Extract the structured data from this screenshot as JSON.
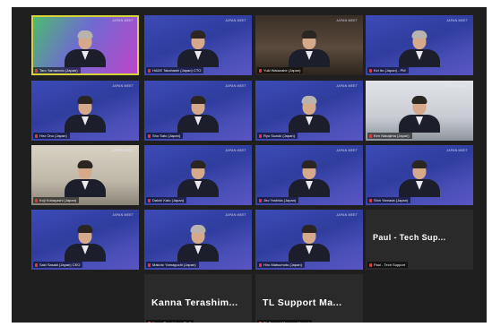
{
  "tiles": [
    {
      "name": "Taro Yamamoto (Japan)",
      "kind": "green",
      "active": true,
      "hair": "grey"
    },
    {
      "name": "HADE Takahashi (Japan) CTO",
      "kind": "video",
      "active": false,
      "hair": "dark"
    },
    {
      "name": "Yuki Watanabe (Japan)",
      "kind": "room3",
      "active": false,
      "hair": "dark"
    },
    {
      "name": "Kei Ito (Japan) - PM",
      "kind": "video",
      "active": false,
      "hair": "grey"
    },
    {
      "name": "Hiro Ono (Japan)",
      "kind": "video",
      "active": false,
      "hair": "dark"
    },
    {
      "name": "Sho Sato (Japan)",
      "kind": "video",
      "active": false,
      "hair": "dark"
    },
    {
      "name": "Ryo Suzuki (Japan)",
      "kind": "video",
      "active": false,
      "hair": "grey"
    },
    {
      "name": "Ken Nakajima (Japan)",
      "kind": "room2",
      "active": false,
      "hair": "dark"
    },
    {
      "name": "Koji Kobayashi (Japan)",
      "kind": "room",
      "active": false,
      "hair": "dark"
    },
    {
      "name": "Daichi Kato (Japan)",
      "kind": "video",
      "active": false,
      "hair": "dark"
    },
    {
      "name": "Jiro Yoshida (Japan)",
      "kind": "video",
      "active": false,
      "hair": "dark"
    },
    {
      "name": "Shin Yamada (Japan)",
      "kind": "video",
      "active": false,
      "hair": "dark"
    },
    {
      "name": "Saki Sasaki (Japan) CEO",
      "kind": "video",
      "active": false,
      "hair": "dark"
    },
    {
      "name": "Makoto Yamaguchi (Japan)",
      "kind": "video",
      "active": false,
      "hair": "grey"
    },
    {
      "name": "Hiro Matsumoto (Japan)",
      "kind": "video",
      "active": false,
      "hair": "dark"
    },
    {
      "name": "Paul - Tech Support",
      "kind": "dark",
      "active": false,
      "bigname": "Paul - Tech Sup..."
    },
    {
      "name": "Kanna Terashima - Staff",
      "kind": "dark",
      "active": false,
      "bigname": "Kanna Terashim..."
    },
    {
      "name": "TL Support Manager (Japan)",
      "kind": "dark",
      "active": false,
      "bigname": "TL Support Ma..."
    }
  ],
  "logo_text": "JAPAN MEET"
}
